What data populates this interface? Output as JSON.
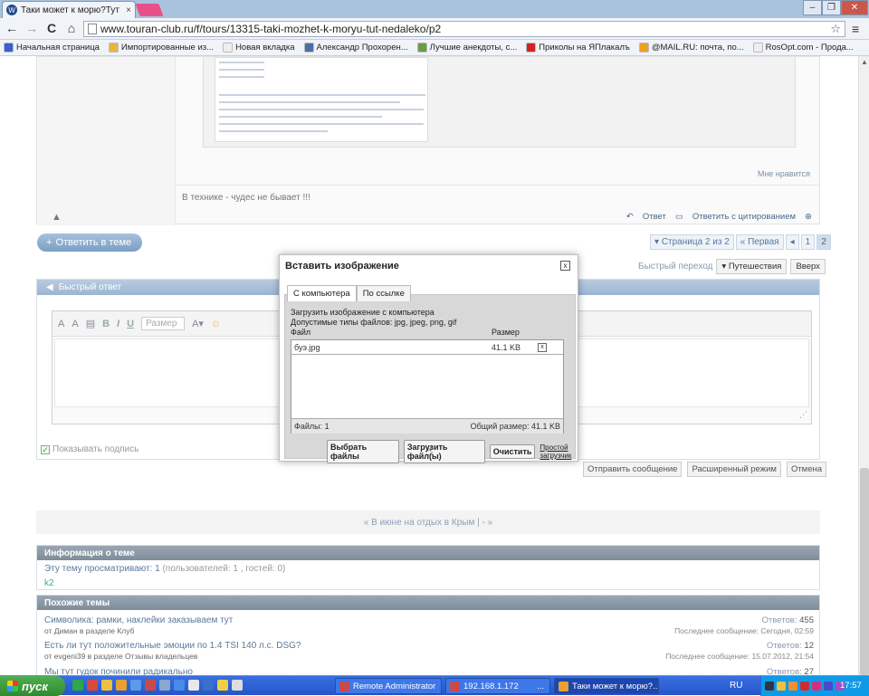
{
  "browser": {
    "tab_title": "Таки может к морю?Тут не...",
    "tab_close": "×",
    "url": "www.touran-club.ru/f/tours/13315-taki-mozhet-k-moryu-tut-nedaleko/p2",
    "win_min": "–",
    "win_max": "❐",
    "win_close": "✕",
    "nav_back": "←",
    "nav_forward": "→",
    "nav_reload": "C",
    "nav_home": "⌂",
    "star": "☆",
    "menu": "≡"
  },
  "bookmarks": [
    {
      "label": "Начальная страница",
      "color": "#3a5fcf"
    },
    {
      "label": "Импортированные из...",
      "color": "#e8b640"
    },
    {
      "label": "Новая вкладка",
      "color": "#eeeeee"
    },
    {
      "label": "Александр Прохорен...",
      "color": "#4a6ea8"
    },
    {
      "label": "Лучшие анекдоты, с...",
      "color": "#6a9a4a"
    },
    {
      "label": "Приколы на ЯПлакалъ",
      "color": "#d22222"
    },
    {
      "label": "@MAIL.RU: почта, по...",
      "color": "#f0a020"
    },
    {
      "label": "RosOpt.com - Прода...",
      "color": "#eeeeee"
    }
  ],
  "post": {
    "like": "Мне нравится",
    "signature": "В технике - чудес не бывает !!!",
    "warn_icon": "▲",
    "reply": "Ответ",
    "quote_reply": "Ответить с цитированием",
    "multi_icon": "⊕"
  },
  "thread": {
    "reply_button": "Ответить в теме",
    "page_label": "Страница 2 из 2",
    "first": "Первая",
    "prev": "◂",
    "p1": "1",
    "p2": "2",
    "quick_jump": "Быстрый переход",
    "jump_value": "Путешествия",
    "up": "Вверх"
  },
  "quick_reply": {
    "title": "Быстрый ответ",
    "font_size_placeholder": "Размер",
    "show_signature": "Показывать подпись",
    "send": "Отправить сообщение",
    "advanced": "Расширенный режим",
    "cancel": "Отмена"
  },
  "thread_nav": "« В июне на отдых в Крым | - »",
  "info": {
    "title": "Информация о теме",
    "viewers_prefix": "Эту тему просматривают: 1",
    "viewers_detail": "(пользователей: 1 , гостей: 0)",
    "user": "k2"
  },
  "similar": {
    "title": "Похожие темы",
    "rows": [
      {
        "title": "Символика: рамки, наклейки заказываем тут",
        "sub": "от Диман в разделе Клуб",
        "replies_label": "Ответов:",
        "replies": "455",
        "last_label": "Последнее сообщение:",
        "last": "Сегодня, 02:59"
      },
      {
        "title": "Есть ли тут положительные эмоции по 1.4 TSI 140 л.с. DSG?",
        "sub": "от evgeni39 в разделе Отзывы владельцев",
        "replies_label": "Ответов:",
        "replies": "12",
        "last_label": "Последнее сообщение:",
        "last": "15.07.2012, 21:54"
      },
      {
        "title": "Мы тут гудок починили радикально",
        "sub": "",
        "replies_label": "Ответов:",
        "replies": "27",
        "last_label": "",
        "last": ""
      }
    ]
  },
  "modal": {
    "title": "Вставить изображение",
    "close": "x",
    "tab_computer": "С компьютера",
    "tab_link": "По ссылке",
    "upload_hint": "Загрузить изображение с компьютера",
    "allowed": "Допустимые типы файлов: jpg, jpeg, png, gif",
    "col_file": "Файл",
    "col_size": "Размер",
    "file_name": "буэ.jpg",
    "file_size": "41.1 KB",
    "file_delete": "x",
    "files_count": "Файлы: 1",
    "total_size": "Общий размер: 41.1 KB",
    "choose": "Выбрать файлы",
    "upload": "Загрузить файл(ы)",
    "clear": "Очистить",
    "simple": "Простой загрузчик"
  },
  "taskbar": {
    "start": "пуск",
    "tasks": [
      {
        "label": "Remote Administrator",
        "color": "#c84a4a"
      },
      {
        "label": "192.168.1.172",
        "color": "#c84a4a"
      },
      {
        "label": "Таки может к морю?...",
        "color": "#e8a030"
      }
    ],
    "lang": "RU",
    "clock": "17:57"
  }
}
